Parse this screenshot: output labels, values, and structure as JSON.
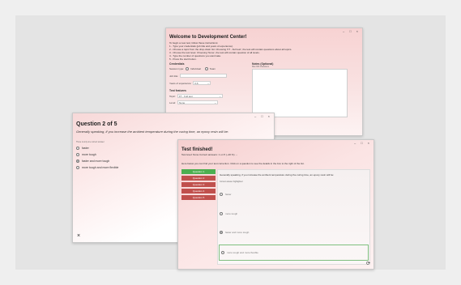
{
  "welcome": {
    "controls": [
      "–",
      "□",
      "×"
    ],
    "title": "Welcome to Development Center!",
    "instructions": [
      "To begin a new test, follow these instructions:",
      "1 - Type your credentials (job title and years of experience).",
      "2 - Choose a topic from the drop-down list. Choosing 'FT - Full test', the test will contain questions about all topics.",
      "3 - Choose the test level. Choosing 'None', the test will contain question of all levels.",
      "4 - Type the number of questions you want take.",
      "5 - Press the start button."
    ],
    "credentials_title": "Credentials",
    "session_type_label": "Session type:",
    "session_individual": "Individual",
    "session_team": "Team",
    "job_title_label": "Job title:",
    "years_label": "Years of experience:",
    "years_value": "0-6",
    "features_title": "Test features",
    "topic_label": "Topic:",
    "topic_value": "FT - Full test",
    "level_label": "Level:",
    "level_value": "None",
    "notes_title": "Notes (Optional)",
    "notes_hint": "Max 300 characters"
  },
  "question": {
    "controls": [
      "–",
      "□",
      "×"
    ],
    "title": "Question  2  of  5",
    "text": "Generally speaking, if you increase the ambient temperature during the curing time, an epoxy resin will be:",
    "hint": "There is only one correct answer",
    "options": [
      "faster",
      "more tough",
      "faster and more tough",
      "more tough and more flexible"
    ],
    "selected_index": 2,
    "close_label": "×"
  },
  "finished": {
    "controls": [
      "–",
      "□",
      "×"
    ],
    "title": "Test finished!",
    "stats": "Test level:  None   Correct answers:  1  on  5  (~20 %)  →",
    "help": "Here below you can find your test correction. Click on a question to see the details in the box to the right of the list.",
    "questions": [
      {
        "label": "Question 1",
        "status": "correct"
      },
      {
        "label": "Question 2",
        "status": "wrong"
      },
      {
        "label": "Question 3",
        "status": "wrong"
      },
      {
        "label": "Question 4",
        "status": "wrong"
      },
      {
        "label": "Question 5",
        "status": "wrong"
      }
    ],
    "detail_text": "Generally speaking, if you increase the ambient temperature during the curing time, an epoxy resin will be:",
    "detail_hint": "Correct answer highlighted",
    "detail_options": [
      "faster",
      "more tough",
      "faster and more tough",
      "more tough and more flexible"
    ],
    "detail_selected_index": 2,
    "detail_correct_index": 3,
    "refresh_icon": "refresh-icon",
    "colors": {
      "correct": "#4caf50",
      "wrong": "#c0504d"
    }
  }
}
